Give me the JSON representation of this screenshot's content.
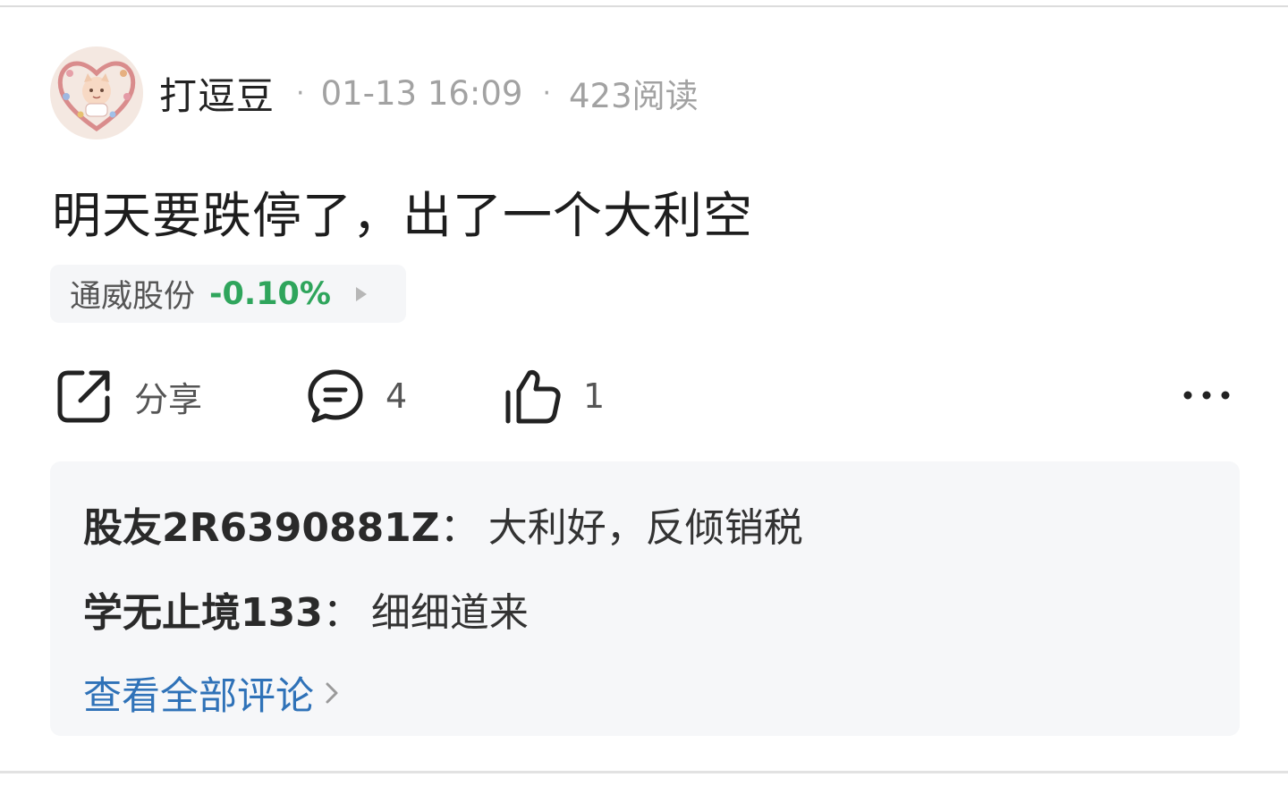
{
  "post": {
    "author": "打逗豆",
    "time": "01-13 16:09",
    "reads": "423阅读",
    "content": "明天要跌停了，出了一个大利空",
    "stock": {
      "name": "通威股份",
      "change": "-0.10%",
      "change_color": "#2fa55c"
    }
  },
  "actions": {
    "share_label": "分享",
    "share_icon": "share-icon",
    "comment_count": "4",
    "comment_icon": "comment-icon",
    "like_count": "1",
    "like_icon": "thumbs-up-icon",
    "more_icon": "more-icon"
  },
  "comments": {
    "items": [
      {
        "author": "股友2R6390881Z",
        "text": "大利好，反倾销税"
      },
      {
        "author": "学无止境133",
        "text": "细细道来"
      }
    ],
    "view_all_label": "查看全部评论",
    "link_color": "#2f72b8"
  }
}
